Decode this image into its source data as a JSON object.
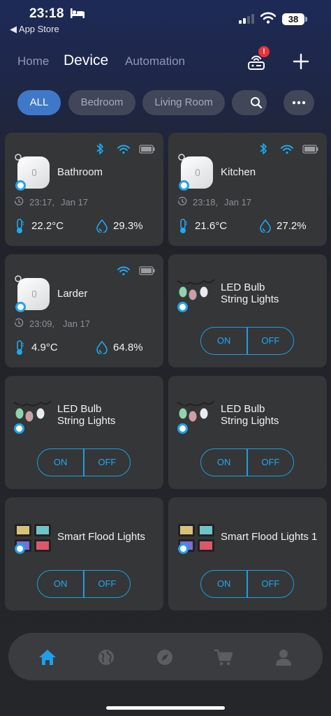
{
  "status_bar": {
    "time": "23:18",
    "back_label": "◀ App Store",
    "battery": "38"
  },
  "nav": {
    "tabs": [
      {
        "label": "Home"
      },
      {
        "label": "Device"
      },
      {
        "label": "Automation"
      }
    ],
    "active_tab": "Device",
    "hub_alert": "!"
  },
  "filters": {
    "chips": [
      {
        "label": "ALL"
      },
      {
        "label": "Bedroom"
      },
      {
        "label": "Living Room"
      }
    ],
    "active": "ALL"
  },
  "devices": [
    {
      "name": "Bathroom",
      "type": "sensor",
      "time": "23:17,",
      "date": "Jan 17",
      "temperature": "22.2°C",
      "humidity": "29.3%",
      "bluetooth": true
    },
    {
      "name": "Kitchen",
      "type": "sensor",
      "time": "23:18,",
      "date": "Jan 17",
      "temperature": "21.6°C",
      "humidity": "27.2%",
      "bluetooth": true
    },
    {
      "name": "Larder",
      "type": "sensor",
      "time": "23:09,",
      "date": "Jan 17",
      "temperature": "4.9°C",
      "humidity": "64.8%",
      "bluetooth": false
    },
    {
      "name_line1": "LED Bulb",
      "name_line2": "String Lights",
      "type": "string-lights",
      "on_label": "ON",
      "off_label": "OFF"
    },
    {
      "name_line1": "LED Bulb",
      "name_line2": "String Lights",
      "type": "string-lights",
      "on_label": "ON",
      "off_label": "OFF"
    },
    {
      "name_line1": "LED Bulb",
      "name_line2": "String Lights",
      "type": "string-lights",
      "on_label": "ON",
      "off_label": "OFF"
    },
    {
      "name": "Smart Flood Lights",
      "type": "flood-lights",
      "on_label": "ON",
      "off_label": "OFF"
    },
    {
      "name": "Smart Flood Lights 1",
      "type": "flood-lights",
      "on_label": "ON",
      "off_label": "OFF"
    }
  ],
  "bottom_nav": {
    "items": [
      {
        "icon": "home-icon",
        "active": true
      },
      {
        "icon": "globe-icon"
      },
      {
        "icon": "compass-icon"
      },
      {
        "icon": "cart-icon"
      },
      {
        "icon": "profile-icon"
      }
    ]
  },
  "colors": {
    "accent": "#1fa9ef",
    "active_chip": "#3f78c9",
    "card": "#353638",
    "alert": "#e8333a"
  }
}
